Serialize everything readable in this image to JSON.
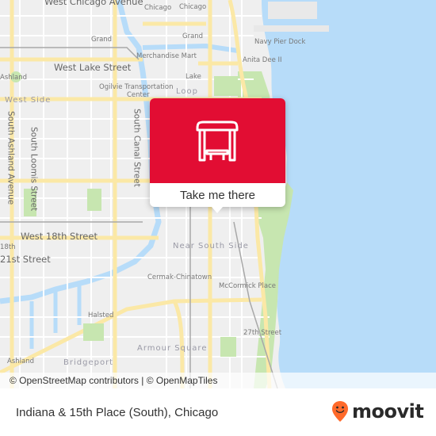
{
  "map": {
    "colors": {
      "land": "#efefef",
      "water": "#b7dcf9",
      "park": "#c7e6b0",
      "major_road": "#fbe8a6",
      "minor_road": "#ffffff",
      "rail": "#a8a8a8"
    },
    "labels": {
      "west_chicago_avenue": "West Chicago Avenue",
      "chicago_1": "Chicago",
      "chicago_2": "Chicago",
      "grand_1": "Grand",
      "grand_2": "Grand",
      "navy_pier_dock": "Navy Pier Dock",
      "merchandise_mart": "Merchandise Mart",
      "anita_dee": "Anita Dee II",
      "ashland_1": "Ashland",
      "west_lake_street": "West Lake Street",
      "ogilvie": "Ogilvie Transportation",
      "ogilvie_center": "Center",
      "lake": "Lake",
      "loop": "Loop",
      "west_side": "West Side",
      "south_ashland_avenue": "South Ashland Avenue",
      "south_loomis_street": "South Loomis Street",
      "south_canal_street": "South Canal Street",
      "west_18th_street": "West 18th Street",
      "18th": "18th",
      "21st_street": "21st Street",
      "near_south_side": "Near South Side",
      "cermak_chinatown": "Cermak-Chinatown",
      "mccormick_place": "McCormick Place",
      "halsted": "Halsted",
      "27th_street": "27th Street",
      "armour_square": "Armour Square",
      "ashland_2": "Ashland",
      "bridgeport": "Bridgeport"
    }
  },
  "popup": {
    "icon": "bus-stop-shelter-icon",
    "accent_color": "#e20d33",
    "cta_label": "Take me there"
  },
  "attribution": {
    "text": "© OpenStreetMap contributors | © OpenMapTiles"
  },
  "footer": {
    "stop_title": "Indiana & 15th Place (South), Chicago",
    "brand": {
      "name": "moovit",
      "color": "#ff6a2b"
    }
  }
}
